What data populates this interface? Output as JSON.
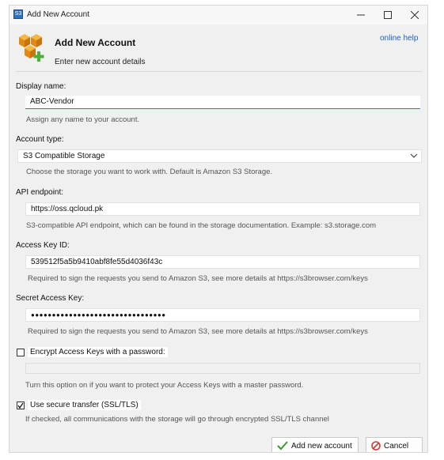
{
  "window": {
    "title": "Add New Account"
  },
  "header": {
    "title": "Add New Account",
    "subtitle": "Enter new account details",
    "help_link": "online help"
  },
  "form": {
    "display_name": {
      "label": "Display name:",
      "value": "ABC-Vendor",
      "hint": "Assign any name to your account."
    },
    "account_type": {
      "label": "Account type:",
      "value": "S3 Compatible Storage",
      "hint": "Choose the storage you want to work with. Default is Amazon S3 Storage."
    },
    "api_endpoint": {
      "label": "API endpoint:",
      "value": "https://oss.qcloud.pk",
      "hint": "S3-compatible API endpoint, which can be found in the storage documentation. Example: s3.storage.com"
    },
    "access_key": {
      "label": "Access Key ID:",
      "value": "539512f5a5b9410abf8fe55d4036f43c",
      "hint": "Required to sign the requests you send to Amazon S3, see more details at https://s3browser.com/keys"
    },
    "secret_key": {
      "label": "Secret Access Key:",
      "value": "●●●●●●●●●●●●●●●●●●●●●●●●●●●●●●●●",
      "hint": "Required to sign the requests you send to Amazon S3, see more details at https://s3browser.com/keys"
    },
    "encrypt_keys": {
      "label": "Encrypt Access Keys with a password:",
      "checked": false,
      "hint": "Turn this option on if you want to protect your Access Keys with a master password."
    },
    "secure_transfer": {
      "label": "Use secure transfer (SSL/TLS)",
      "checked": true,
      "hint": "If checked, all communications with the storage will go through encrypted SSL/TLS channel"
    }
  },
  "buttons": {
    "add": "Add new account",
    "cancel": "Cancel"
  },
  "colors": {
    "accent": "#3b6fc4",
    "link": "#1f5fb8",
    "window_bg": "#f0f0f0"
  }
}
